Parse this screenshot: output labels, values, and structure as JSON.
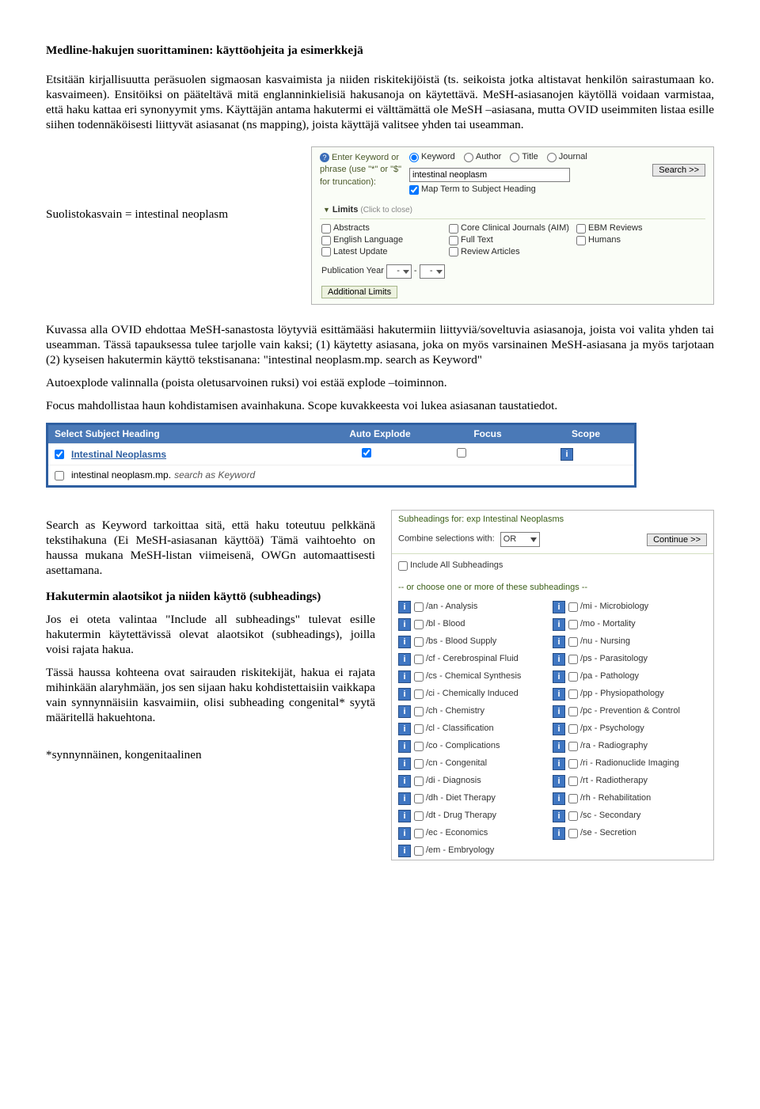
{
  "doc": {
    "title": "Medline-hakujen suorittaminen: käyttöohjeita ja esimerkkejä",
    "p1": "Etsitään kirjallisuutta peräsuolen sigmaosan kasvaimista ja niiden riskitekijöistä (ts. seikoista jotka altistavat henkilön sairastumaan ko. kasvaimeen). Ensitöiksi on pääteltävä mitä englanninkielisiä hakusanoja on käytettävä. MeSH-asiasanojen käytöllä voidaan varmistaa, että haku kattaa eri synonyymit yms. Käyttäjän antama hakutermi ei välttämättä ole MeSH –asiasana, mutta OVID useimmiten listaa esille siihen todennäköisesti liittyvät asiasanat (ns mapping), joista käyttäjä valitsee yhden tai useamman.",
    "side_label": "Suolistokasvain = intestinal neoplasm",
    "p2": "Kuvassa alla OVID ehdottaa MeSH-sanastosta löytyviä esittämääsi hakutermiin liittyviä/soveltuvia asiasanoja, joista voi valita yhden tai useamman. Tässä tapauksessa tulee tarjolle vain kaksi; (1) käytetty asiasana, joka on myös varsinainen MeSH-asiasana ja myös tarjotaan (2) kyseisen hakutermin käyttö tekstisanana: \"intestinal neoplasm.mp. search as Keyword\"",
    "p3": "Autoexplode valinnalla (poista oletusarvoinen ruksi) voi estää explode –toiminnon.",
    "p4": "Focus mahdollistaa haun kohdistamisen avainhakuna. Scope kuvakkeesta voi lukea asiasanan taustatiedot.",
    "p5": "Search as Keyword tarkoittaa sitä, että haku toteutuu pelkkänä tekstihakuna (Ei MeSH-asiasanan käyttöä) Tämä vaihtoehto on haussa mukana MeSH-listan viimeisenä, OWGn automaattisesti asettamana.",
    "h2": "Hakutermin alaotsikot ja niiden käyttö (subheadings)",
    "p6": "Jos ei oteta valintaa \"Include all subheadings\" tulevat esille hakutermin käytettävissä olevat alaotsikot (subheadings), joilla voisi rajata hakua.",
    "p7": "Tässä haussa kohteena ovat sairauden riskitekijät, hakua ei rajata mihinkään alaryhmään, jos sen sijaan haku kohdistettaisiin vaikkapa vain synnynnäisiin kasvaimiin, olisi subheading congenital* syytä määritellä hakuehtona.",
    "foot": "*synnynnäinen, kongenitaalinen"
  },
  "search": {
    "prompt": "Enter Keyword or phrase (use \"*\" or \"$\" for truncation):",
    "radios": [
      "Keyword",
      "Author",
      "Title",
      "Journal"
    ],
    "value": "intestinal neoplasm",
    "map": "Map Term to Subject Heading",
    "btn": "Search >>",
    "limits_title": "Limits",
    "limits_hint": "(Click to close)",
    "limits": [
      [
        "Abstracts",
        "English Language",
        "Latest Update"
      ],
      [
        "Core Clinical Journals (AIM)",
        "Full Text",
        "Review Articles"
      ],
      [
        "EBM Reviews",
        "Humans"
      ]
    ],
    "pubyear": "Publication Year",
    "add": "Additional Limits"
  },
  "subject": {
    "headers": [
      "Select Subject Heading",
      "Auto Explode",
      "Focus",
      "Scope"
    ],
    "rows": [
      {
        "label": "Intestinal Neoplasms",
        "link": true,
        "auto": true,
        "focus": false,
        "scope": true
      },
      {
        "label": "intestinal neoplasm.mp.",
        "suffix": "search as Keyword",
        "link": false,
        "auto": null,
        "focus": null,
        "scope": false
      }
    ]
  },
  "subh": {
    "title": "Subheadings for: exp Intestinal Neoplasms",
    "combine": "Combine selections with:",
    "op": "OR",
    "cont": "Continue >>",
    "all": "Include All Subheadings",
    "hint": "-- or choose one or more of these subheadings --",
    "left": [
      "/an - Analysis",
      "/bl - Blood",
      "/bs - Blood Supply",
      "/cf - Cerebrospinal Fluid",
      "/cs - Chemical Synthesis",
      "/ci - Chemically Induced",
      "/ch - Chemistry",
      "/cl - Classification",
      "/co - Complications",
      "/cn - Congenital",
      "/di - Diagnosis",
      "/dh - Diet Therapy",
      "/dt - Drug Therapy",
      "/ec - Economics",
      "/em - Embryology"
    ],
    "right": [
      "/mi - Microbiology",
      "/mo - Mortality",
      "/nu - Nursing",
      "/ps - Parasitology",
      "/pa - Pathology",
      "/pp - Physiopathology",
      "/pc - Prevention & Control",
      "/px - Psychology",
      "/ra - Radiography",
      "/ri - Radionuclide Imaging",
      "/rt - Radiotherapy",
      "/rh - Rehabilitation",
      "/sc - Secondary",
      "/se - Secretion"
    ]
  }
}
